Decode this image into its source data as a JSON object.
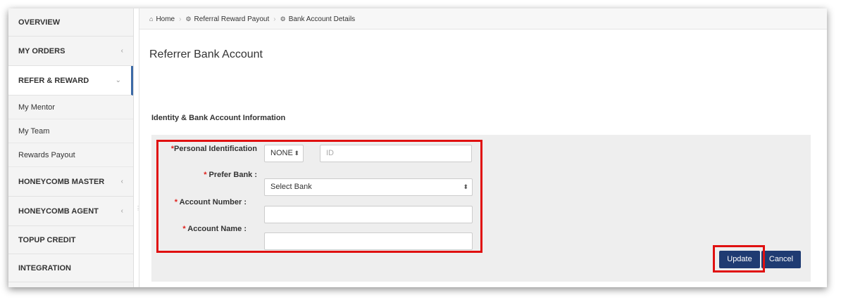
{
  "sidebar": {
    "overview": "OVERVIEW",
    "my_orders": "MY ORDERS",
    "refer_reward": "REFER & REWARD",
    "sub_items": [
      "My Mentor",
      "My Team",
      "Rewards Payout"
    ],
    "honeycomb_master": "HONEYCOMB MASTER",
    "honeycomb_agent": "HONEYCOMB AGENT",
    "topup_credit": "TOPUP CREDIT",
    "integration": "INTEGRATION",
    "chev_collapsed": "‹",
    "chev_expanded": "⌄"
  },
  "breadcrumb": {
    "home": "Home",
    "referral": "Referral Reward Payout",
    "current": "Bank Account Details",
    "separator": "›",
    "home_icon": "⌂",
    "gear_icon": "⚙"
  },
  "page": {
    "title": "Referrer Bank Account",
    "section": "Identity & Bank Account Information"
  },
  "form": {
    "required_mark": "*",
    "personal_id_label": "Personal Identification",
    "id_type_value": "NONE",
    "id_placeholder": "ID",
    "prefer_bank_label": " Prefer Bank :",
    "bank_select_value": "Select Bank",
    "account_number_label": " Account Number :",
    "account_number_value": "",
    "account_name_label": " Account Name :",
    "account_name_value": "",
    "select_arrows": "⬍"
  },
  "actions": {
    "update": "Update",
    "cancel": "Cancel"
  },
  "colors": {
    "primary_button": "#1f3b72",
    "highlight": "#e01010",
    "required": "#e0211c"
  }
}
